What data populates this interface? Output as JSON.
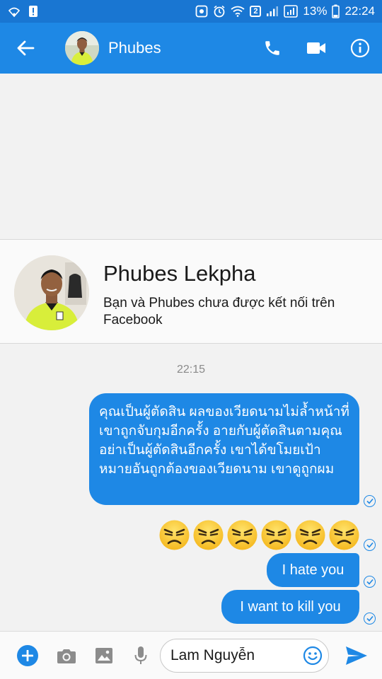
{
  "status_bar": {
    "network_badge": "2",
    "battery_percent": "13%",
    "time": "22:24"
  },
  "header": {
    "contact_name": "Phubes"
  },
  "profile": {
    "full_name": "Phubes Lekpha",
    "subtitle": "Bạn và Phubes chưa được kết nối trên Facebook"
  },
  "conversation": {
    "timestamp": "22:15",
    "messages": [
      "คุณเป็นผู้ตัดสิน ผลของเวียดนามไม่ล้ำหน้าที่เขาถูกจับกุมอีกครั้ง อายกับผู้ตัดสินตามคุณ อย่าเป็นผู้ตัดสินอีกครั้ง เขาได้ขโมยเป้าหมายอันถูกต้องของเวียดนาม เขาดูถูกผม",
      "I hate you",
      "I want to kill you"
    ],
    "emoji_count": 6,
    "emoji_icon": "angry-face-icon"
  },
  "composer": {
    "value": "Lam Nguyễn"
  },
  "colors": {
    "accent": "#1e88e5",
    "status_bar": "#1976d2",
    "background": "#f2f2f2"
  }
}
